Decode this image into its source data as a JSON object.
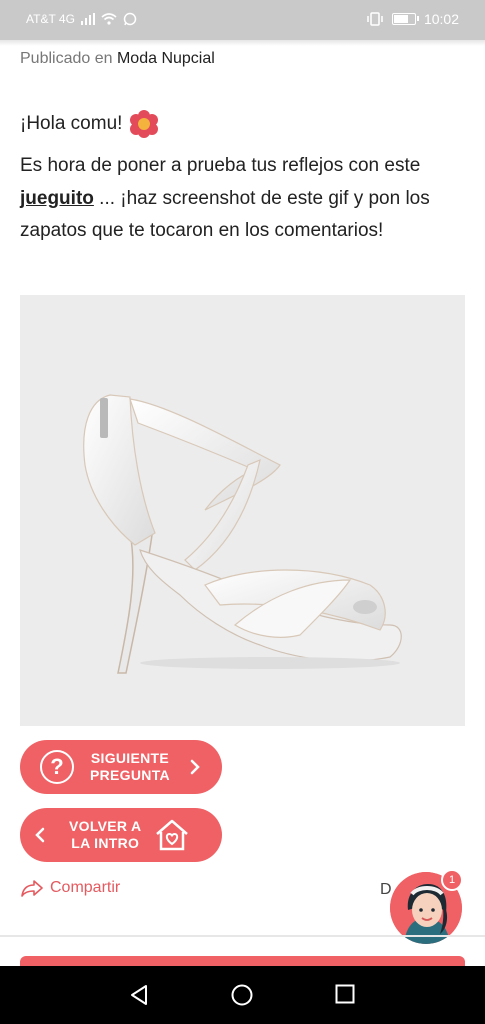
{
  "status_bar": {
    "carrier": "AT&T 4G",
    "time": "10:02"
  },
  "post": {
    "published_prefix": "Publicado en",
    "category": "Moda Nupcial",
    "greeting": "¡Hola comu!",
    "body_before_link": "Es hora de poner a prueba tus reflejos con este ",
    "link_text": "jueguito",
    "body_after_link": " ... ¡haz screenshot de este gif y pon los zapatos que te tocaron en los comentarios!"
  },
  "buttons": {
    "next_line1": "SIGUIENTE",
    "next_line2": "PREGUNTA",
    "back_line1": "VOLVER A",
    "back_line2": "LA INTRO"
  },
  "share": {
    "label": "Compartir",
    "right_text": "D"
  },
  "notification": {
    "count": "1"
  },
  "colors": {
    "accent": "#ef6164",
    "statusbar": "#c9c9c9"
  }
}
